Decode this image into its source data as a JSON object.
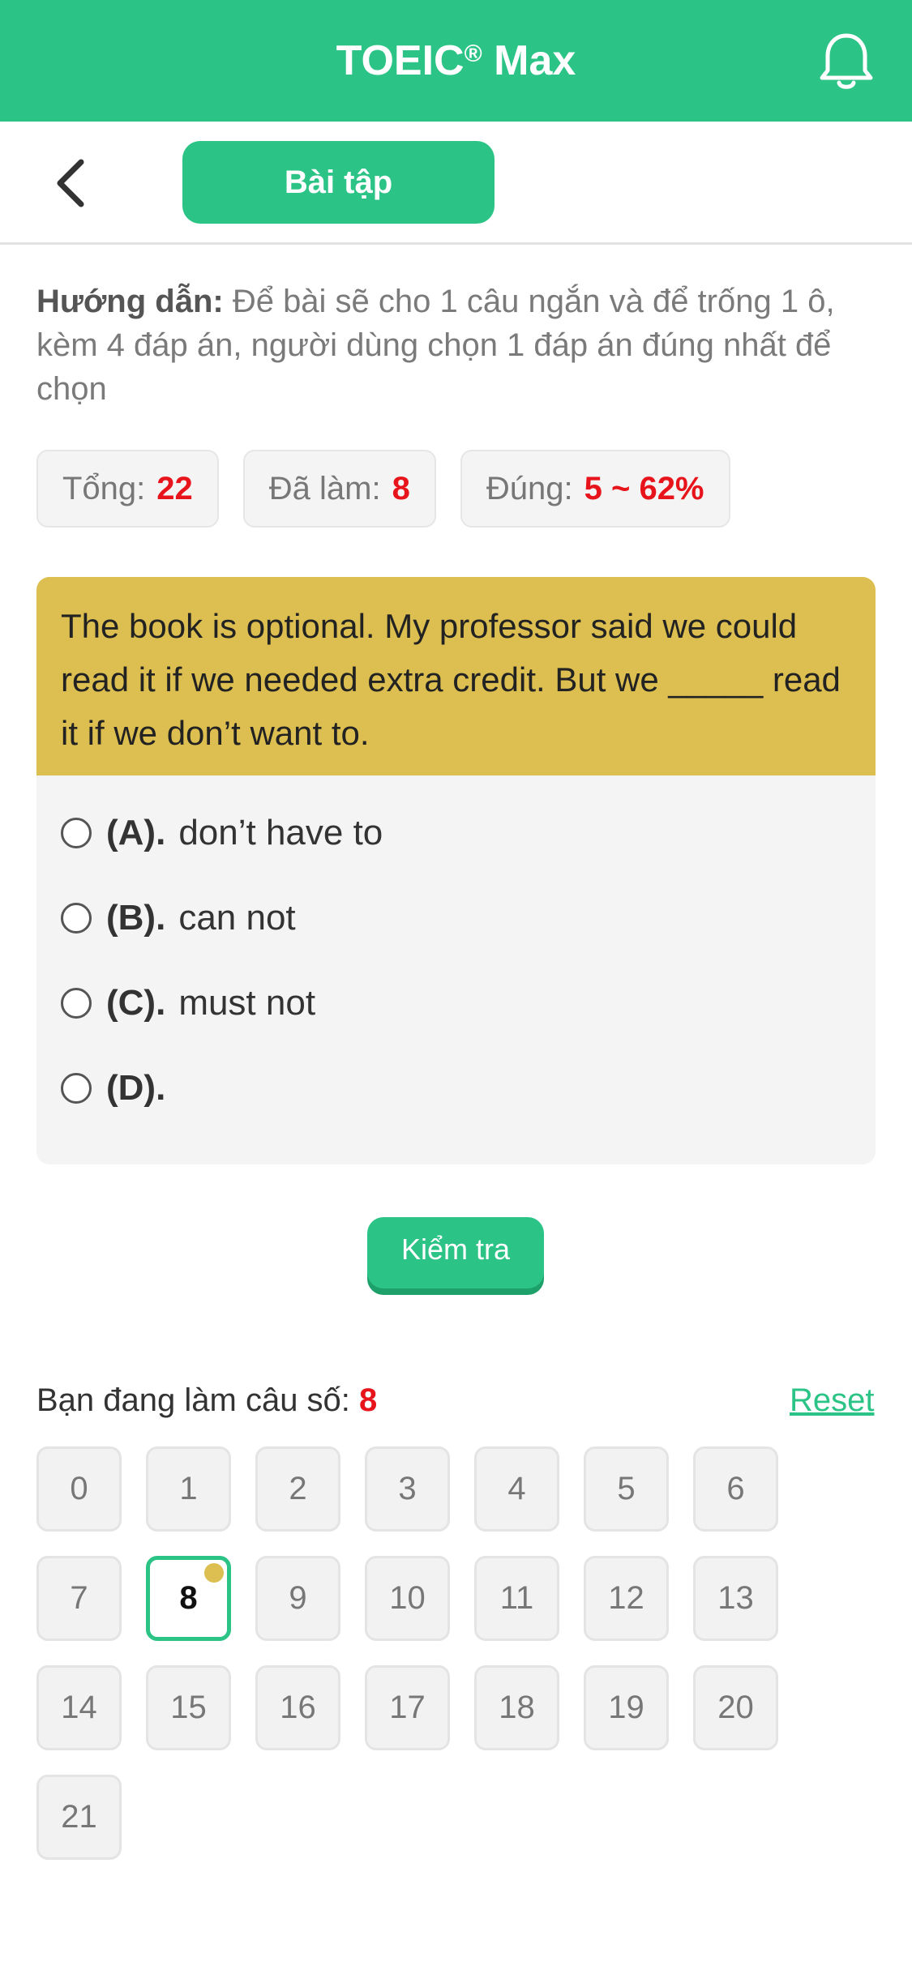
{
  "appbar": {
    "title": "TOEIC",
    "title_mark": "®",
    "title_suffix": " Max",
    "icon": "bell-icon"
  },
  "subbar": {
    "back_icon": "chevron-left-icon",
    "tab_label": "Bài tập"
  },
  "guide": {
    "label": "Hướng dẫn:",
    "text": " Để bài sẽ cho 1 câu ngắn và để trống 1 ô, kèm 4 đáp án, người dùng chọn 1 đáp án đúng nhất để chọn"
  },
  "stats": [
    {
      "label": "Tổng:",
      "value": "22"
    },
    {
      "label": "Đã làm:",
      "value": "8"
    },
    {
      "label": "Đúng:",
      "value": "5 ~ 62%"
    }
  ],
  "question": {
    "text": "The book is optional. My professor said we could read it if we needed extra credit. But we _____ read it if we don’t want to.",
    "options": [
      {
        "key": "(A).",
        "text": "don’t have to"
      },
      {
        "key": "(B).",
        "text": "can not"
      },
      {
        "key": "(C).",
        "text": "must not"
      },
      {
        "key": "(D).",
        "text": ""
      }
    ]
  },
  "check_button": "Kiểm tra",
  "progress": {
    "label": "Bạn đang làm câu số:",
    "current": "8",
    "reset_label": "Reset"
  },
  "questions_grid": [
    "0",
    "1",
    "2",
    "3",
    "4",
    "5",
    "6",
    "7",
    "8",
    "9",
    "10",
    "11",
    "12",
    "13",
    "14",
    "15",
    "16",
    "17",
    "18",
    "19",
    "20",
    "21"
  ],
  "colors": {
    "primary": "#2cc486",
    "question_bg": "#dcbf50",
    "accent_red": "#e8141b"
  }
}
